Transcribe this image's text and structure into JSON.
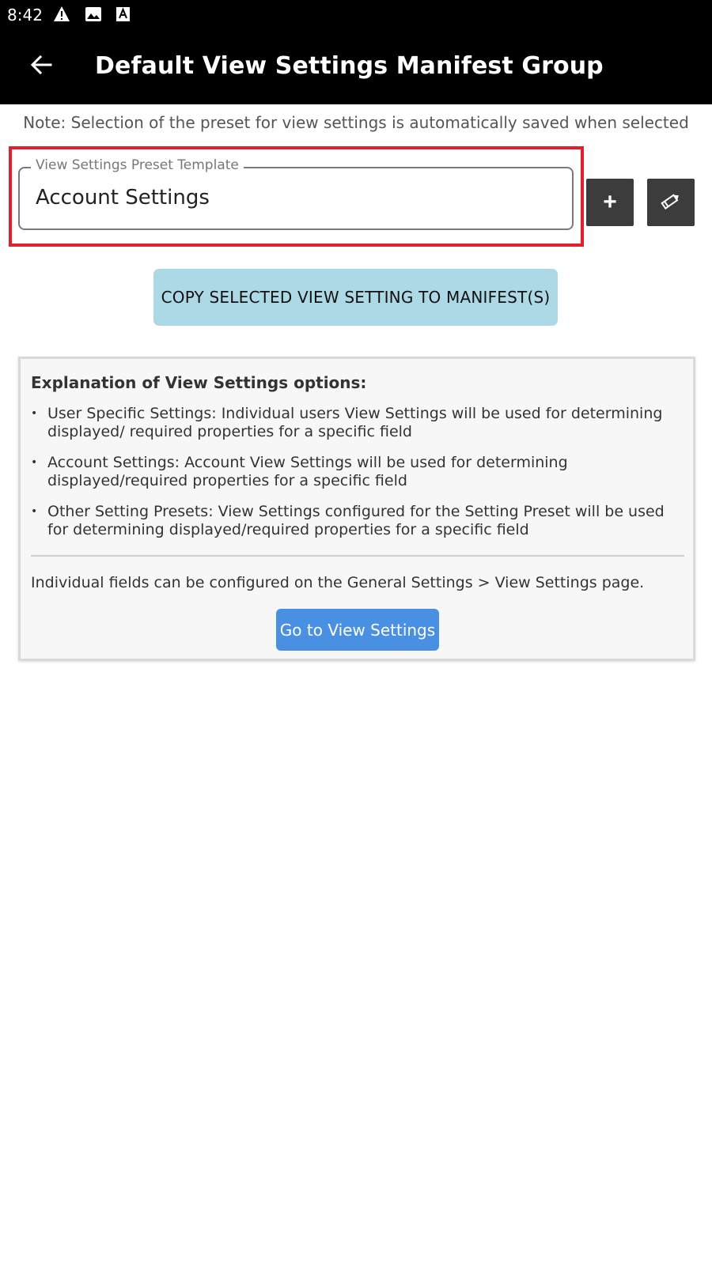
{
  "status_bar": {
    "time": "8:42",
    "icons": [
      "warning-icon",
      "image-icon",
      "text-recognition-icon"
    ]
  },
  "app_bar": {
    "title": "Default View Settings Manifest Group",
    "back_icon": "arrow-left-icon"
  },
  "note": "Note: Selection of the preset for view settings is automatically saved when selected",
  "preset_field": {
    "label": "View Settings Preset Template",
    "value": "Account Settings"
  },
  "buttons": {
    "add_label": "+",
    "edit_icon": "pencil-icon",
    "copy_label": "COPY SELECTED VIEW SETTING TO MANIFEST(S)",
    "goto_label": "Go to View Settings"
  },
  "explanation": {
    "title": "Explanation of View Settings options:",
    "items": [
      "User Specific Settings: Individual users View Settings will be used for determining displayed/ required properties for a specific field",
      "Account Settings: Account View Settings will be used for determining displayed/required properties for a specific field",
      "Other Setting Presets: View Settings configured for the Setting Preset will be used for determining displayed/required properties for a specific field"
    ],
    "info": "Individual fields can be configured on the General Settings > View Settings page."
  },
  "colors": {
    "app_bar": "#000000",
    "highlight_border": "#e1202c",
    "copy_button": "#add8e6",
    "goto_button": "#4a90e2",
    "square_buttons": "#3c3c3c"
  }
}
